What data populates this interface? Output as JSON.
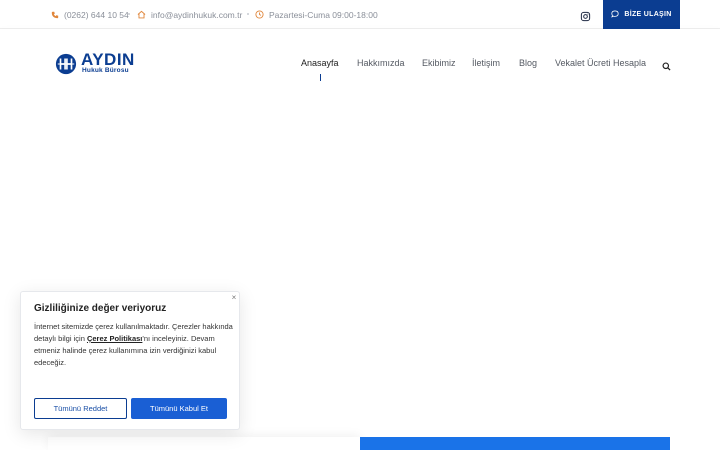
{
  "topbar": {
    "phone": "(0262) 644 10 54",
    "email": "info@aydinhukuk.com.tr",
    "hours": "Pazartesi-Cuma 09:00-18:00",
    "cta_label": "BİZE ULAŞIN"
  },
  "brand": {
    "name": "AYDIN",
    "subtitle": "Hukuk Bürosu",
    "color": "#0b3d91"
  },
  "nav": {
    "items": [
      {
        "label": "Anasayfa"
      },
      {
        "label": "Hakkımızda"
      },
      {
        "label": "Ekibimiz"
      },
      {
        "label": "İletişim"
      },
      {
        "label": "Blog"
      },
      {
        "label": "Vekalet Ücreti Hesapla"
      }
    ]
  },
  "cookie": {
    "title": "Gizliliğinize değer veriyoruz",
    "text_before": "İnternet sitemizde çerez kullanılmaktadır. Çerezler hakkında detaylı bilgi için ",
    "link_label": "Çerez Politikası",
    "text_after": "'nı inceleyiniz. Devam etmeniz halinde çerez kullanımına izin verdiğinizi kabul edeceğiz.",
    "reject_label": "Tümünü Reddet",
    "accept_label": "Tümünü Kabul Et",
    "close_glyph": "×"
  },
  "colors": {
    "accent": "#1a5fd4",
    "panel_blue": "#1a73e8"
  }
}
